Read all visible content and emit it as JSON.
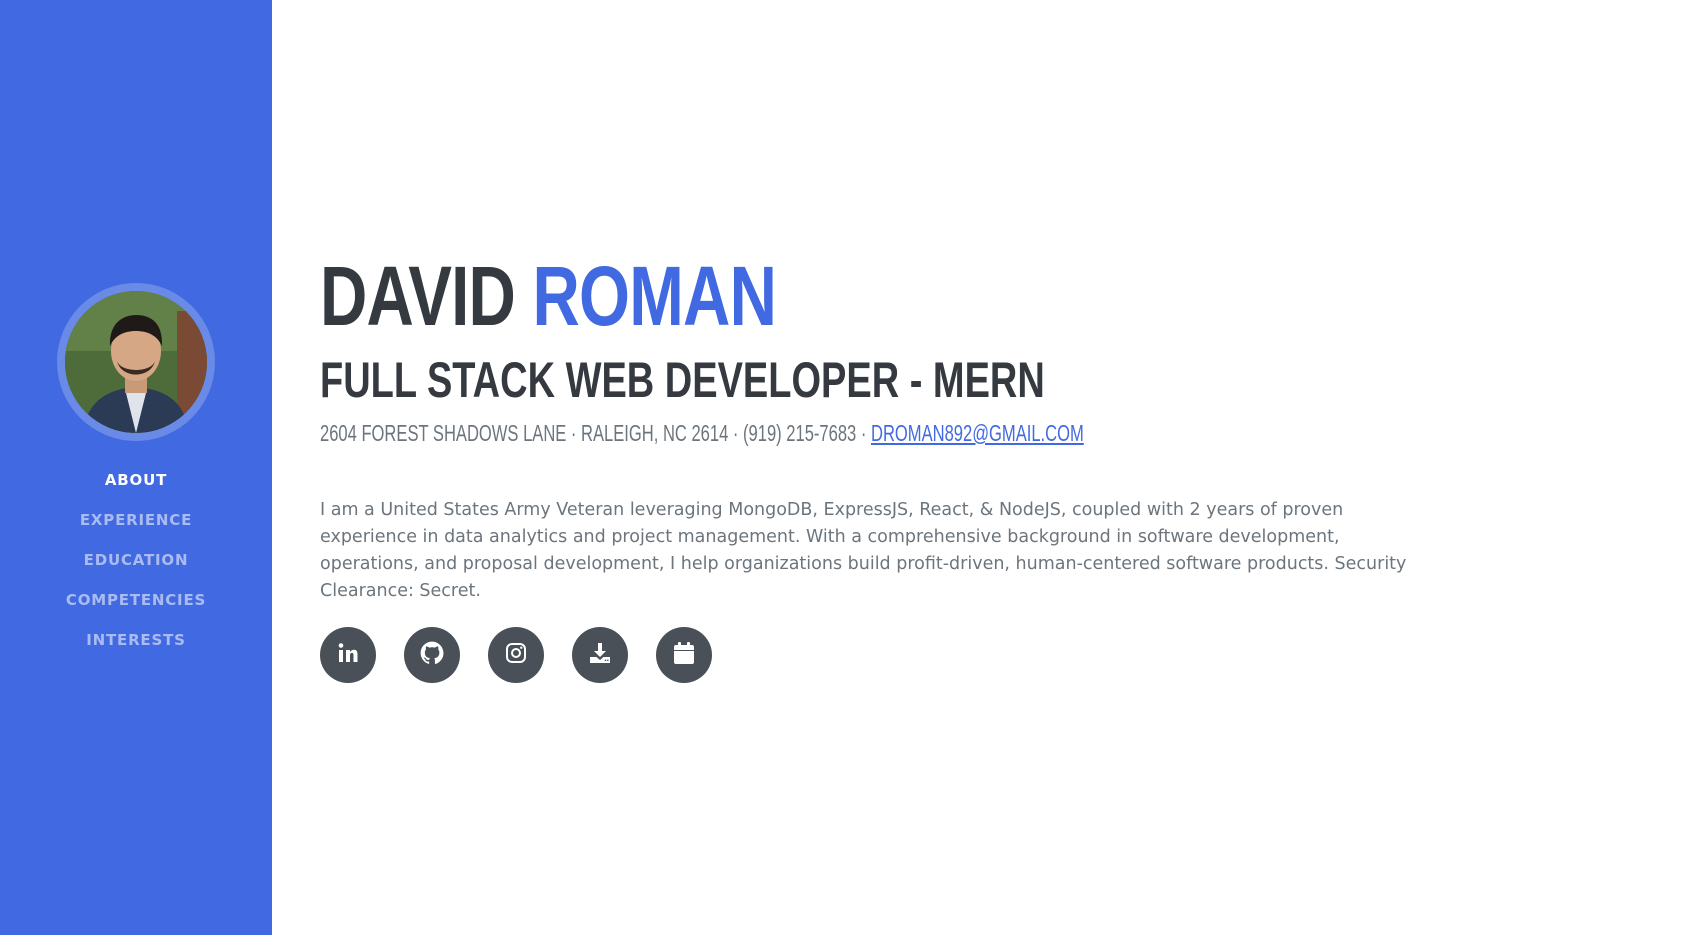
{
  "profile": {
    "first_name": "DAVID",
    "last_name": "ROMAN",
    "title": "FULL STACK WEB DEVELOPER - MERN",
    "address": "2604 FOREST SHADOWS LANE · RALEIGH, NC 2614 · (919) 215-7683 · ",
    "email": "DROMAN892@GMAIL.COM",
    "bio": "I am a United States Army Veteran leveraging MongoDB, ExpressJS, React, & NodeJS, coupled with 2 years of proven experience in data analytics and project management. With a comprehensive background in software development, operations, and proposal development, I help organizations build profit-driven, human-centered software products. Security Clearance: Secret."
  },
  "sidebar": {
    "nav": [
      {
        "label": "ABOUT",
        "active": true
      },
      {
        "label": "EXPERIENCE",
        "active": false
      },
      {
        "label": "EDUCATION",
        "active": false
      },
      {
        "label": "COMPETENCIES",
        "active": false
      },
      {
        "label": "INTERESTS",
        "active": false
      }
    ]
  },
  "social": [
    {
      "icon": "linkedin-icon"
    },
    {
      "icon": "github-icon"
    },
    {
      "icon": "instagram-icon"
    },
    {
      "icon": "download-icon"
    },
    {
      "icon": "calendar-icon"
    }
  ],
  "colors": {
    "primary": "#4169e1",
    "heading": "#343a40",
    "text": "#6c757d",
    "social_bg": "#495057"
  }
}
